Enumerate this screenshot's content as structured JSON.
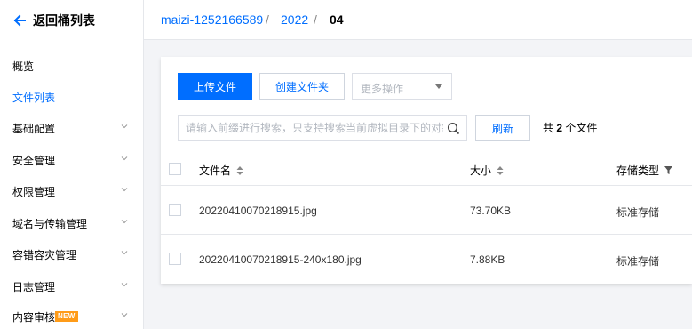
{
  "sidebar": {
    "back_label": "返回桶列表",
    "items": [
      {
        "label": "概览",
        "has_chevron": false,
        "active": false
      },
      {
        "label": "文件列表",
        "has_chevron": false,
        "active": true
      },
      {
        "label": "基础配置",
        "has_chevron": true,
        "active": false
      },
      {
        "label": "安全管理",
        "has_chevron": true,
        "active": false
      },
      {
        "label": "权限管理",
        "has_chevron": true,
        "active": false
      },
      {
        "label": "域名与传输管理",
        "has_chevron": true,
        "active": false
      },
      {
        "label": "容错容灾管理",
        "has_chevron": true,
        "active": false
      },
      {
        "label": "日志管理",
        "has_chevron": true,
        "active": false
      },
      {
        "label": "内容审核",
        "has_chevron": true,
        "active": false,
        "badge": "NEW"
      }
    ]
  },
  "breadcrumb": {
    "bucket": "maizi-1252166589",
    "folder1": "2022",
    "current": "04",
    "separator": "/"
  },
  "toolbar": {
    "upload_label": "上传文件",
    "create_folder_label": "创建文件夹",
    "more_actions_label": "更多操作",
    "search_placeholder": "请输入前缀进行搜索，只支持搜索当前虚拟目录下的对象",
    "refresh_label": "刷新",
    "count_prefix": "共",
    "count_value": "2",
    "count_suffix": "个文件"
  },
  "table": {
    "columns": {
      "name": "文件名",
      "size": "大小",
      "storage": "存储类型"
    },
    "rows": [
      {
        "name": "20220410070218915.jpg",
        "size": "73.70KB",
        "storage": "标准存储"
      },
      {
        "name": "20220410070218915-240x180.jpg",
        "size": "7.88KB",
        "storage": "标准存储"
      }
    ]
  },
  "colors": {
    "accent": "#006eff",
    "badge": "#ff9c19"
  }
}
